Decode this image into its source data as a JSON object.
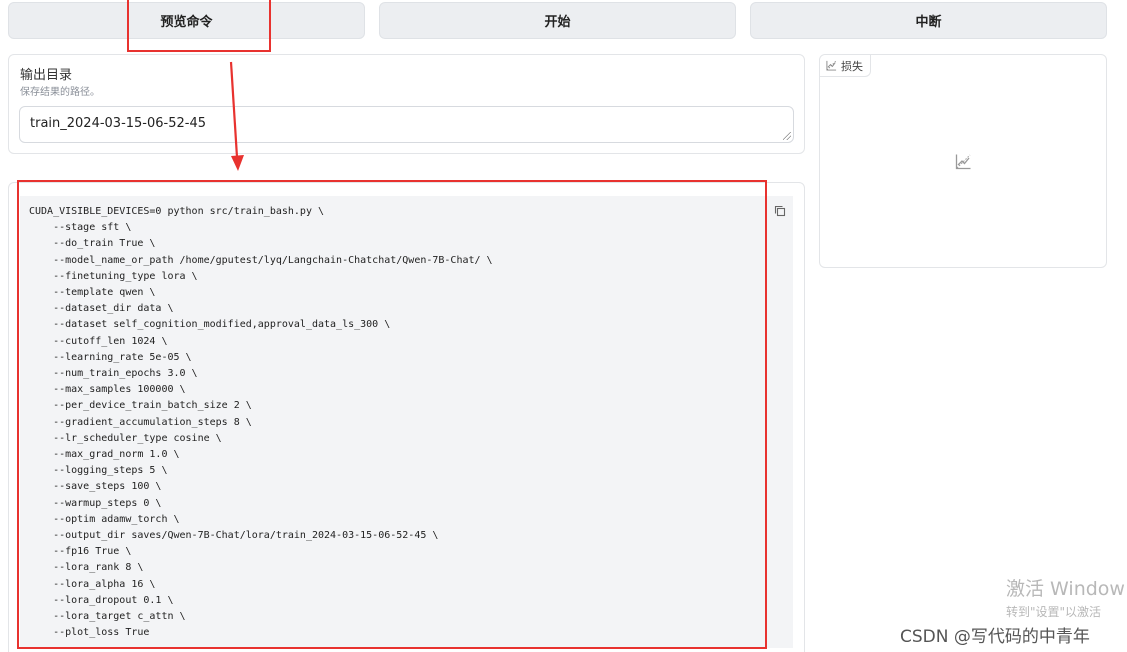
{
  "toolbar": {
    "preview_label": "预览命令",
    "start_label": "开始",
    "interrupt_label": "中断"
  },
  "output_dir": {
    "label": "输出目录",
    "description": "保存结果的路径。",
    "value": "train_2024-03-15-06-52-45"
  },
  "command_preview": {
    "lines": [
      "CUDA_VISIBLE_DEVICES=0 python src/train_bash.py \\",
      "    --stage sft \\",
      "    --do_train True \\",
      "    --model_name_or_path /home/gputest/lyq/Langchain-Chatchat/Qwen-7B-Chat/ \\",
      "    --finetuning_type lora \\",
      "    --template qwen \\",
      "    --dataset_dir data \\",
      "    --dataset self_cognition_modified,approval_data_ls_300 \\",
      "    --cutoff_len 1024 \\",
      "    --learning_rate 5e-05 \\",
      "    --num_train_epochs 3.0 \\",
      "    --max_samples 100000 \\",
      "    --per_device_train_batch_size 2 \\",
      "    --gradient_accumulation_steps 8 \\",
      "    --lr_scheduler_type cosine \\",
      "    --max_grad_norm 1.0 \\",
      "    --logging_steps 5 \\",
      "    --save_steps 100 \\",
      "    --warmup_steps 0 \\",
      "    --optim adamw_torch \\",
      "    --output_dir saves/Qwen-7B-Chat/lora/train_2024-03-15-06-52-45 \\",
      "    --fp16 True \\",
      "    --lora_rank 8 \\",
      "    --lora_alpha 16 \\",
      "    --lora_dropout 0.1 \\",
      "    --lora_target c_attn \\",
      "    --plot_loss True"
    ]
  },
  "loss_plot": {
    "tab_label": "损失"
  },
  "watermark": {
    "line1": "激活 Window",
    "line2": "转到\"设置\"以激活",
    "csdn": "CSDN @写代码的中青年"
  },
  "colors": {
    "annotation_red": "#e8322f",
    "button_bg": "#eceef1",
    "code_bg": "#f3f4f6"
  }
}
